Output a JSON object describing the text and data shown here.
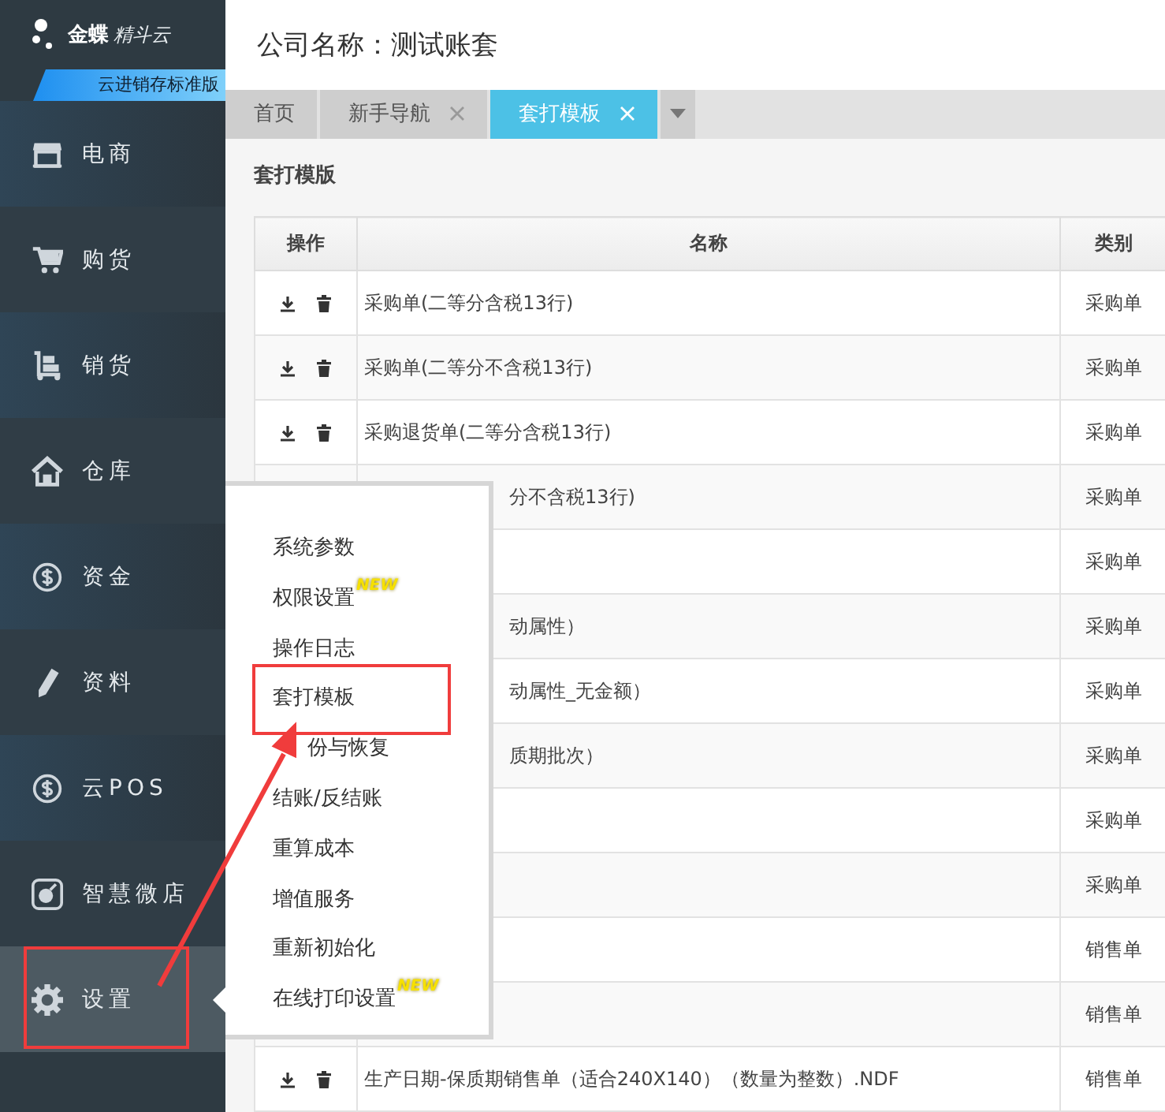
{
  "logo": {
    "brand": "金蝶",
    "product": "精斗云",
    "edition": "云进销存标准版"
  },
  "nav": [
    {
      "kind": "shop",
      "label": "电商",
      "selected": false
    },
    {
      "kind": "cart",
      "label": "购货",
      "selected": false
    },
    {
      "kind": "trolley",
      "label": "销货",
      "selected": false
    },
    {
      "kind": "house",
      "label": "仓库",
      "selected": false
    },
    {
      "kind": "dollar",
      "label": "资金",
      "selected": false
    },
    {
      "kind": "pencil",
      "label": "资料",
      "selected": false
    },
    {
      "kind": "dollar",
      "label": "云POS",
      "selected": false
    },
    {
      "kind": "store",
      "label": "智慧微店",
      "selected": false
    },
    {
      "kind": "gear",
      "label": "设置",
      "selected": true
    }
  ],
  "header": {
    "title": "公司名称：测试账套"
  },
  "tabs": [
    {
      "label": "首页",
      "closable": false,
      "selected": false
    },
    {
      "label": "新手导航",
      "closable": true,
      "selected": false
    },
    {
      "label": "套打模板",
      "closable": true,
      "selected": true
    }
  ],
  "page_title": "套打模版",
  "table": {
    "columns": [
      "操作",
      "名称",
      "类别"
    ],
    "rows": [
      {
        "actions": true,
        "name": "采购单(二等分含税13行)",
        "category": "采购单"
      },
      {
        "actions": true,
        "name": "采购单(二等分不含税13行)",
        "category": "采购单"
      },
      {
        "actions": true,
        "name": "采购退货单(二等分含税13行)",
        "category": "采购单"
      },
      {
        "name": "分不含税13行)",
        "category": "采购单"
      },
      {
        "category": "采购单"
      },
      {
        "name": "动属性）",
        "category": "采购单"
      },
      {
        "name": "动属性_无金额）",
        "category": "采购单"
      },
      {
        "name": "质期批次）",
        "category": "采购单"
      },
      {
        "category": "采购单"
      },
      {
        "category": "采购单"
      },
      {
        "category": "销售单"
      },
      {
        "category": "销售单"
      },
      {
        "actions": true,
        "name": "生产日期-保质期销售单（适合240X140）（数量为整数）.NDF",
        "category": "销售单"
      }
    ]
  },
  "settings_menu": {
    "items": [
      {
        "label": "系统参数"
      },
      {
        "label": "权限设置",
        "badge": "NEW"
      },
      {
        "label": "操作日志"
      },
      {
        "label": "套打模板",
        "highlighted": true
      },
      {
        "label": "份与恢复",
        "covered": true
      },
      {
        "label": "结账/反结账"
      },
      {
        "label": "重算成本"
      },
      {
        "label": "增值服务"
      },
      {
        "label": "重新初始化"
      },
      {
        "label": "在线打印设置",
        "badge": "NEW"
      }
    ]
  }
}
